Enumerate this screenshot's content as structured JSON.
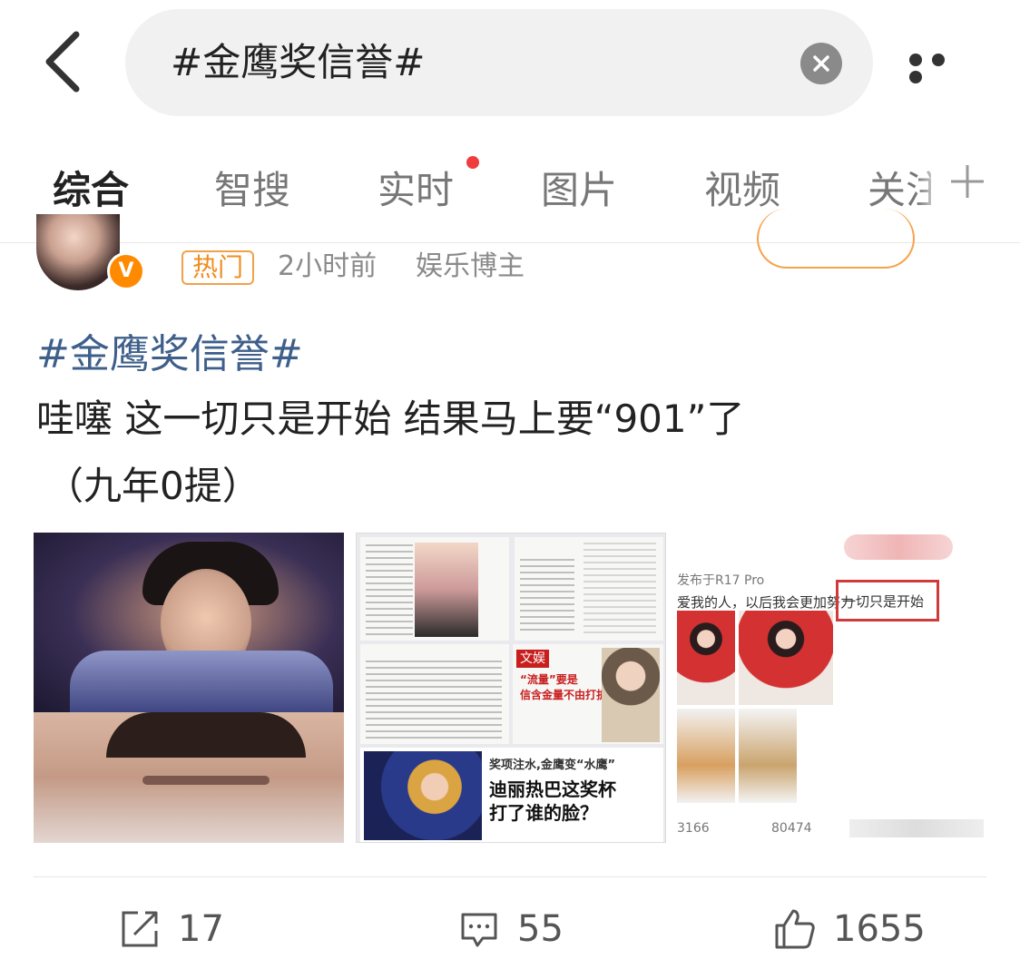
{
  "search": {
    "query": "#金鹰奖信誉#"
  },
  "tabs": [
    {
      "label": "综合",
      "active": true
    },
    {
      "label": "智搜"
    },
    {
      "label": "实时",
      "has_dot": true
    },
    {
      "label": "图片"
    },
    {
      "label": "视频"
    },
    {
      "label": "关注"
    }
  ],
  "post": {
    "hot_tag": "热门",
    "time": "2小时前",
    "author_type": "娱乐博主",
    "verified_badge": "V",
    "hashtag": "#金鹰奖信誉#",
    "text_line1": "哇噻 这一切只是开始 结果马上要“901”了",
    "text_line2": "（九年0提）",
    "images": {
      "img2": {
        "red_tag": "文娱",
        "headline_small": "“流量”要是\n信含金量不由打折",
        "headline1": "奖项注水,金鹰变“水鹰”",
        "headline2": "迪丽热巴这奖杯",
        "headline3": "打了谁的脸？"
      },
      "img3": {
        "device": "发布于R17 Pro",
        "line": "爱我的人，以后我会更加努力",
        "highlight": "一切只是开始",
        "num_left": "3166",
        "num_right": "80474"
      }
    }
  },
  "actions": {
    "repost": "17",
    "comment": "55",
    "like": "1655"
  },
  "colors": {
    "accent": "#ff8200",
    "hashtag": "#3e5f8a",
    "hot": "#f08c1e"
  }
}
